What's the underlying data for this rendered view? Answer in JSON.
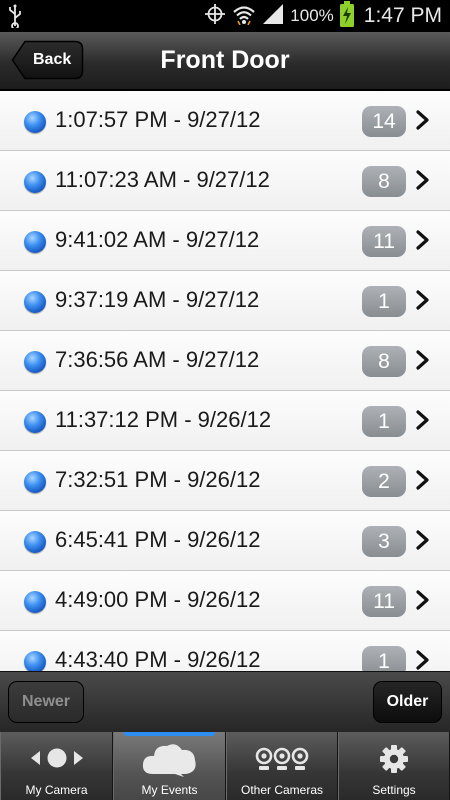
{
  "status_bar": {
    "battery_percent": "100%",
    "time": "1:47 PM",
    "icons": [
      "usb-icon",
      "gps-icon",
      "wifi-icon",
      "signal-icon",
      "battery-charging-icon"
    ]
  },
  "header": {
    "back_label": "Back",
    "title": "Front Door"
  },
  "events": [
    {
      "label": "1:07:57 PM - 9/27/12",
      "count": "14"
    },
    {
      "label": "11:07:23 AM - 9/27/12",
      "count": "8"
    },
    {
      "label": "9:41:02 AM - 9/27/12",
      "count": "11"
    },
    {
      "label": "9:37:19 AM - 9/27/12",
      "count": "1"
    },
    {
      "label": "7:36:56 AM - 9/27/12",
      "count": "8"
    },
    {
      "label": "11:37:12 PM - 9/26/12",
      "count": "1"
    },
    {
      "label": "7:32:51 PM - 9/26/12",
      "count": "2"
    },
    {
      "label": "6:45:41 PM - 9/26/12",
      "count": "3"
    },
    {
      "label": "4:49:00 PM - 9/26/12",
      "count": "11"
    },
    {
      "label": "4:43:40 PM - 9/26/12",
      "count": "1"
    }
  ],
  "paging": {
    "newer_label": "Newer",
    "older_label": "Older"
  },
  "tabs": [
    {
      "label": "My Camera",
      "icon": "camera-nav-icon",
      "active": false
    },
    {
      "label": "My Events",
      "icon": "cloud-icon",
      "active": true
    },
    {
      "label": "Other Cameras",
      "icon": "cameras-group-icon",
      "active": false
    },
    {
      "label": "Settings",
      "icon": "gear-icon",
      "active": false
    }
  ],
  "colors": {
    "accent": "#2d8df0",
    "badge": "#9a9ea3",
    "header_bg": "#2b2b2b",
    "list_bg": "#f6f6f6"
  }
}
